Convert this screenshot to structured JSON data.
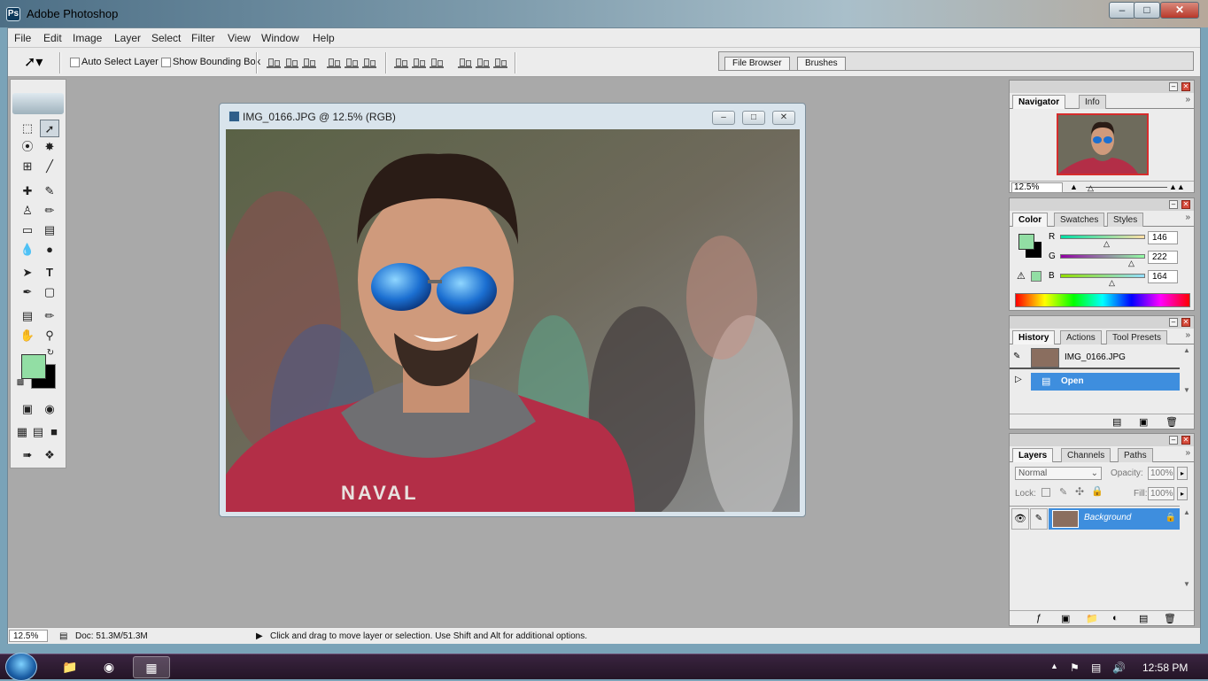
{
  "window": {
    "title": "Adobe Photoshop",
    "logo_text": "Ps"
  },
  "menu": [
    "File",
    "Edit",
    "Image",
    "Layer",
    "Select",
    "Filter",
    "View",
    "Window",
    "Help"
  ],
  "options": {
    "auto_select_label": "Auto Select Layer",
    "auto_select_checked": false,
    "bounding_box_label": "Show Bounding Box",
    "bounding_box_checked": false
  },
  "palette_well": {
    "tabs": [
      "File Browser",
      "Brushes"
    ]
  },
  "colors": {
    "foreground": "#92dea4",
    "background": "#000000",
    "selection": "#3e8ede"
  },
  "document": {
    "title": "IMG_0166.JPG @ 12.5% (RGB)"
  },
  "navigator": {
    "tabs": [
      "Navigator",
      "Info"
    ],
    "zoom": "12.5%"
  },
  "color_panel": {
    "tabs": [
      "Color",
      "Swatches",
      "Styles"
    ],
    "channels": [
      {
        "label": "R",
        "value": "146"
      },
      {
        "label": "G",
        "value": "222"
      },
      {
        "label": "B",
        "value": "164"
      }
    ]
  },
  "history": {
    "tabs": [
      "History",
      "Actions",
      "Tool Presets"
    ],
    "snapshot": "IMG_0166.JPG",
    "states": [
      "Open"
    ]
  },
  "layers": {
    "tabs": [
      "Layers",
      "Channels",
      "Paths"
    ],
    "blend_mode": "Normal",
    "opacity_label": "Opacity:",
    "opacity": "100%",
    "lock_label": "Lock:",
    "fill_label": "Fill:",
    "fill": "100%",
    "items": [
      {
        "name": "Background"
      }
    ]
  },
  "status": {
    "zoom": "12.5%",
    "doc": "Doc: 51.3M/51.3M",
    "hint": "Click and drag to move layer or selection.  Use Shift and Alt for additional options."
  },
  "taskbar": {
    "time": "12:58 PM"
  }
}
